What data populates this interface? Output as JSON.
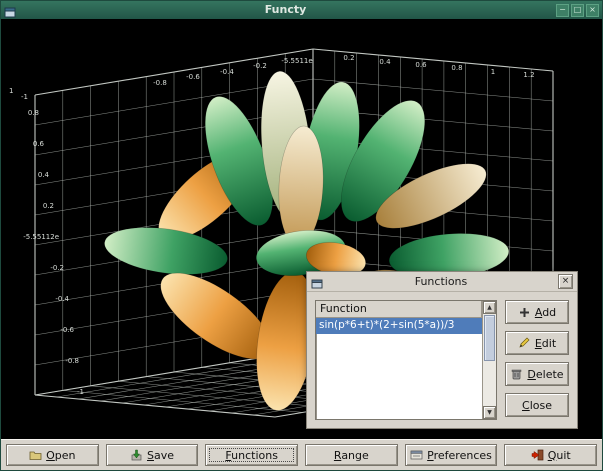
{
  "window": {
    "title": "Functy"
  },
  "icons": {
    "minimize": "−",
    "maximize": "□",
    "close": "×",
    "dialog_close": "×",
    "scroll_up": "▲",
    "scroll_down": "▼"
  },
  "plot": {
    "axis_labels": {
      "top_left": [
        "-0.8",
        "-0.6",
        "-0.4",
        "-0.2",
        "-5.5511e"
      ],
      "top_right": [
        "0.2",
        "0.4",
        "0.6",
        "0.8",
        "1",
        "1.2"
      ],
      "left": [
        "0.8",
        "0.6",
        "0.4",
        "0.2",
        "-5.55112e",
        "-0.2",
        "-0.4",
        "-0.6",
        "-0.8",
        "-1"
      ],
      "corner_left": "1",
      "corner_right": "-1"
    }
  },
  "dialog": {
    "title": "Functions",
    "list": {
      "header": "Function",
      "rows": [
        "sin(p*6+t)*(2+sin(5*a))/3"
      ],
      "selected_index": 0
    },
    "buttons": [
      {
        "label": "Add"
      },
      {
        "label": "Edit"
      },
      {
        "label": "Delete"
      },
      {
        "label": "Close"
      }
    ]
  },
  "toolbar": {
    "buttons": [
      {
        "label": "Open"
      },
      {
        "label": "Save"
      },
      {
        "label": "Functions"
      },
      {
        "label": "Range"
      },
      {
        "label": "Preferences"
      },
      {
        "label": "Quit"
      }
    ]
  },
  "colors": {
    "titlebar": "#2c6b58",
    "selection": "#4f7cba",
    "plot_background": "#000000",
    "chrome": "#d8d4cc",
    "petal_green": "#1f8c4a",
    "petal_orange": "#e8952f"
  }
}
